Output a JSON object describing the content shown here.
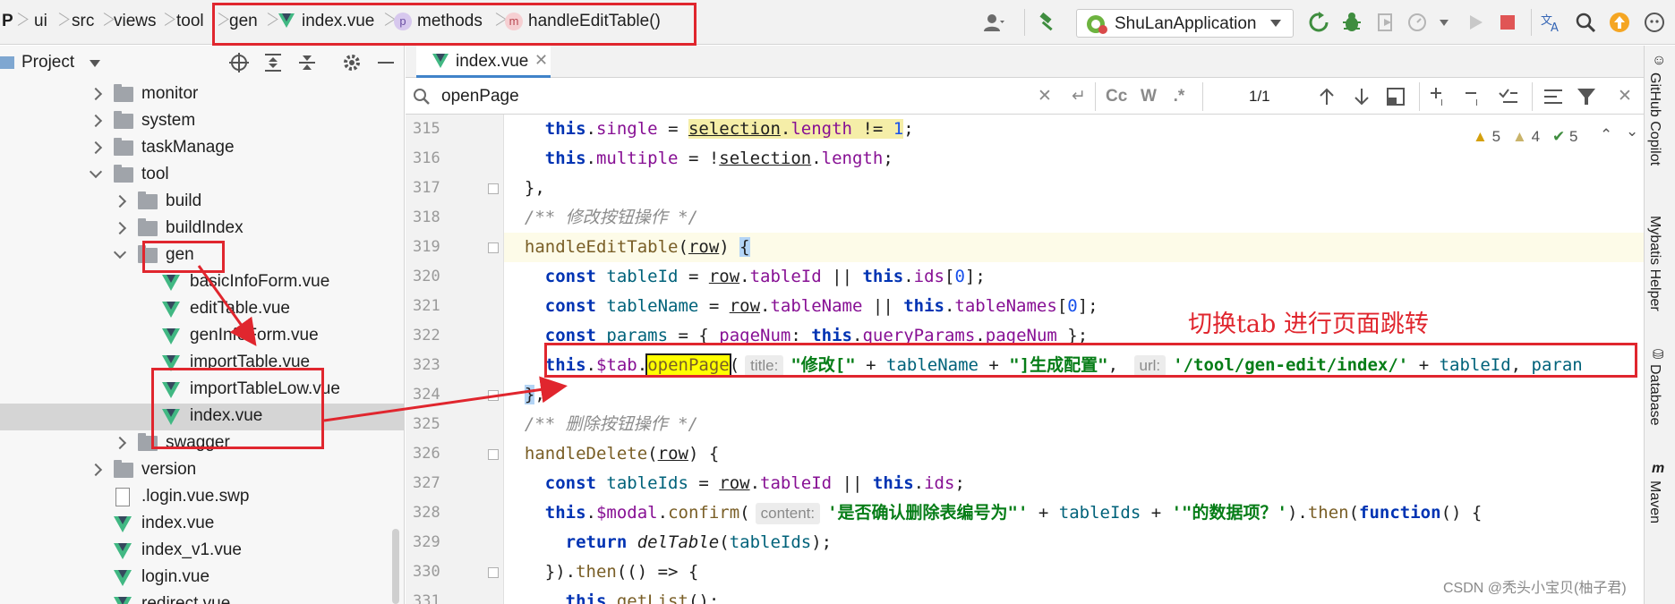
{
  "breadcrumb": {
    "items": [
      "P",
      "ui",
      "src",
      "views",
      "tool",
      "gen",
      "index.vue",
      "methods",
      "handleEditTable()"
    ]
  },
  "toolbar": {
    "run_config_label": "ShuLanApplication"
  },
  "project_panel": {
    "title": "Project",
    "tree": [
      {
        "label": "monitor",
        "type": "folder",
        "state": "collapsed"
      },
      {
        "label": "system",
        "type": "folder",
        "state": "collapsed"
      },
      {
        "label": "taskManage",
        "type": "folder",
        "state": "collapsed"
      },
      {
        "label": "tool",
        "type": "folder",
        "state": "expanded"
      },
      {
        "label": "build",
        "type": "folder",
        "state": "collapsed"
      },
      {
        "label": "buildIndex",
        "type": "folder",
        "state": "collapsed"
      },
      {
        "label": "gen",
        "type": "folder",
        "state": "expanded"
      },
      {
        "label": "basicInfoForm.vue",
        "type": "vue"
      },
      {
        "label": "editTable.vue",
        "type": "vue"
      },
      {
        "label": "genInfoForm.vue",
        "type": "vue"
      },
      {
        "label": "importTable.vue",
        "type": "vue"
      },
      {
        "label": "importTableLow.vue",
        "type": "vue"
      },
      {
        "label": "index.vue",
        "type": "vue",
        "selected": true
      },
      {
        "label": "swagger",
        "type": "folder",
        "state": "collapsed"
      },
      {
        "label": "version",
        "type": "folder",
        "state": "collapsed"
      },
      {
        "label": ".login.vue.swp",
        "type": "file"
      },
      {
        "label": "index.vue",
        "type": "vue"
      },
      {
        "label": "index_v1.vue",
        "type": "vue"
      },
      {
        "label": "login.vue",
        "type": "vue"
      },
      {
        "label": "redirect.vue",
        "type": "vue"
      }
    ]
  },
  "editor": {
    "tab_label": "index.vue",
    "search_query": "openPage",
    "search_options": [
      "Cc",
      "W",
      ".*"
    ],
    "match_count": "1/1",
    "inspections": {
      "errors": "5",
      "warnings": "4",
      "ok": "5"
    },
    "line_numbers": [
      "315",
      "316",
      "317",
      "318",
      "319",
      "320",
      "321",
      "322",
      "323",
      "324",
      "325",
      "326",
      "327",
      "328",
      "329",
      "330",
      "331"
    ],
    "hints": {
      "title": "title:",
      "url": "url:",
      "content": "content:"
    },
    "code": {
      "l315_this": "this",
      "l315_single": "single",
      "l315_sel": "selection",
      "l315_len": "length",
      "l315_op": " != ",
      "l315_num": "1",
      "l315_end": ";",
      "l316_this": "this",
      "l316_multiple": "multiple",
      "l316_sel": "selection",
      "l316_len": "length",
      "l316_end": ";",
      "l317": "},",
      "l318": "/** 修改按钮操作 */",
      "l319_fn": "handleEditTable",
      "l319_arg": "row",
      "l319_end": "{",
      "l320_const": "const",
      "l320_var": "tableId",
      "l320_row": "row",
      "l320_prop": "tableId",
      "l320_this": "this",
      "l320_ids": "ids",
      "l320_num": "0",
      "l321_const": "const",
      "l321_var": "tableName",
      "l321_row": "row",
      "l321_prop": "tableName",
      "l321_this": "this",
      "l321_names": "tableNames",
      "l321_num": "0",
      "l322_const": "const",
      "l322_var": "params",
      "l322_key": "pageNum",
      "l322_this": "this",
      "l322_qp": "queryParams",
      "l322_pn": "pageNum",
      "l323_this": "this",
      "l323_tab": "$tab",
      "l323_open": "openPage",
      "l323_str1": "\"修改[\"",
      "l323_var": "tableName",
      "l323_str2": "\"]生成配置\"",
      "l323_str3": "'/tool/gen-edit/index/'",
      "l323_id": "tableId",
      "l323_tail": "paran",
      "l324": "}",
      "l325": "/** 删除按钮操作 */",
      "l326_fn": "handleDelete",
      "l326_arg": "row",
      "l327_const": "const",
      "l327_var": "tableIds",
      "l327_row": "row",
      "l327_prop": "tableId",
      "l327_this": "this",
      "l327_ids": "ids",
      "l328_this": "this",
      "l328_modal": "$modal",
      "l328_confirm": "confirm",
      "l328_str1": "'是否确认删除表编号为\"'",
      "l328_var": "tableIds",
      "l328_str2": "'\"的数据项？'",
      "l328_then": "then",
      "l328_function": "function",
      "l329_return": "return",
      "l329_fn": "delTable",
      "l329_var": "tableIds",
      "l330_then": "then",
      "l331_this": "this",
      "l331_fn": "getList"
    }
  },
  "right_tools": [
    "GitHub Copilot",
    "Mybatis Helper",
    "Database",
    "Maven"
  ],
  "annotation": {
    "text": "切换tab 进行页面跳转"
  },
  "watermark": "CSDN @秃头小宝贝(柚子君)",
  "colors": {
    "annotation_red": "#e0262e",
    "vue_green": "#41b883",
    "search_highlight": "#ffff00"
  }
}
